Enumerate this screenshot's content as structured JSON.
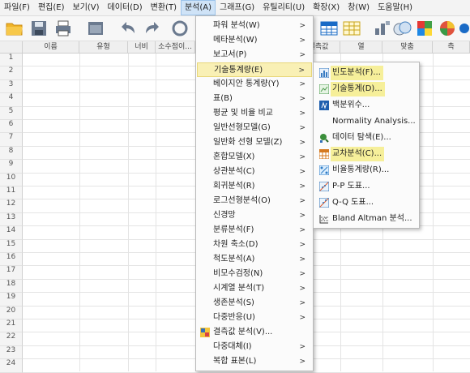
{
  "menubar": {
    "items": [
      "파일(F)",
      "편집(E)",
      "보기(V)",
      "데이터(D)",
      "변환(T)",
      "분석(A)",
      "그래프(G)",
      "유틸리티(U)",
      "확장(X)",
      "창(W)",
      "도움말(H)"
    ]
  },
  "grid": {
    "columns": [
      "이름",
      "유형",
      "너비",
      "소수점이...",
      "결측값",
      "열",
      "맞춤",
      "측"
    ],
    "rows": [
      "1",
      "2",
      "3",
      "4",
      "5",
      "6",
      "7",
      "8",
      "9",
      "10",
      "11",
      "12",
      "13",
      "14",
      "15",
      "16",
      "17",
      "18",
      "19",
      "20",
      "21",
      "22",
      "23",
      "24"
    ]
  },
  "analyze_menu": {
    "items": [
      {
        "label": "파워 분석(W)",
        "submenu": true
      },
      {
        "label": "메타분석(W)",
        "submenu": true
      },
      {
        "label": "보고서(P)",
        "submenu": true
      },
      {
        "label": "기술통계량(E)",
        "submenu": true,
        "highlighted": true
      },
      {
        "label": "베이지안 통계량(Y)",
        "submenu": true
      },
      {
        "label": "표(B)",
        "submenu": true
      },
      {
        "label": "평균 및 비율 비교",
        "submenu": true
      },
      {
        "label": "일반선형모델(G)",
        "submenu": true
      },
      {
        "label": "일반화 선형 모델(Z)",
        "submenu": true
      },
      {
        "label": "혼합모델(X)",
        "submenu": true
      },
      {
        "label": "상관분석(C)",
        "submenu": true
      },
      {
        "label": "회귀분석(R)",
        "submenu": true
      },
      {
        "label": "로그선형분석(O)",
        "submenu": true
      },
      {
        "label": "신경망",
        "submenu": true
      },
      {
        "label": "분류분석(F)",
        "submenu": true
      },
      {
        "label": "차원 축소(D)",
        "submenu": true
      },
      {
        "label": "척도분석(A)",
        "submenu": true
      },
      {
        "label": "비모수검정(N)",
        "submenu": true
      },
      {
        "label": "시계열 분석(T)",
        "submenu": true
      },
      {
        "label": "생존분석(S)",
        "submenu": true
      },
      {
        "label": "다중반응(U)",
        "submenu": true
      },
      {
        "label": "결측값 분석(V)...",
        "submenu": false,
        "icon": "missing-values-icon"
      },
      {
        "label": "다중대체(I)",
        "submenu": true
      },
      {
        "label": "복합 표본(L)",
        "submenu": true
      }
    ]
  },
  "descriptive_menu": {
    "items": [
      {
        "label": "빈도분석(F)...",
        "icon": "frequencies-icon",
        "highlighted": true
      },
      {
        "label": "기술통계(D)...",
        "icon": "descriptives-icon",
        "highlighted": true
      },
      {
        "label": "백분위수...",
        "icon": "percentiles-icon",
        "highlighted": false
      },
      {
        "label": "Normality Analysis...",
        "icon": "",
        "highlighted": false
      },
      {
        "label": "데이터 탐색(E)...",
        "icon": "explore-icon",
        "highlighted": false
      },
      {
        "label": "교차분석(C)...",
        "icon": "crosstabs-icon",
        "highlighted": true
      },
      {
        "label": "비율통계량(R)...",
        "icon": "ratio-icon",
        "highlighted": false
      },
      {
        "label": "P-P 도표...",
        "icon": "pp-plot-icon",
        "highlighted": false
      },
      {
        "label": "Q-Q 도표...",
        "icon": "qq-plot-icon",
        "highlighted": false
      },
      {
        "label": "Bland Altman 분석...",
        "icon": "bland-altman-icon",
        "highlighted": false
      }
    ]
  }
}
